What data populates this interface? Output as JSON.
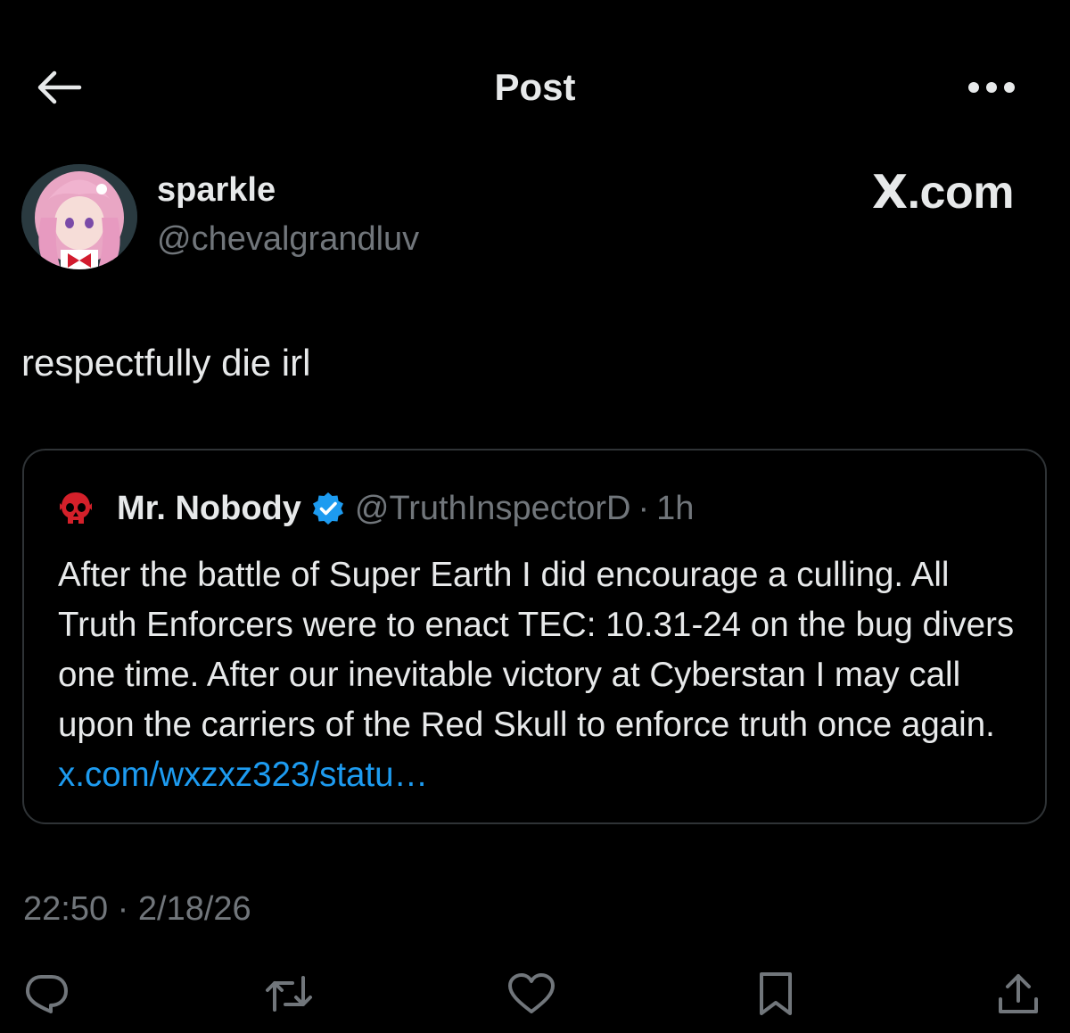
{
  "header": {
    "title": "Post",
    "back_icon": "arrow-left-icon",
    "more_icon": "more-horizontal-icon"
  },
  "author": {
    "display_name": "sparkle",
    "handle": "@chevalgrandluv",
    "avatar_icon": "profile-avatar"
  },
  "watermark": {
    "x": "X",
    "rest": ".com"
  },
  "post": {
    "text": "respectfully die irl"
  },
  "quote": {
    "display_name": "Mr. Nobody",
    "handle": "@TruthInspectorD",
    "separator": "·",
    "time": "1h",
    "body": "After the battle of Super Earth I did encourage a culling. All Truth Enforcers were to enact TEC: 10.31-24 on the bug divers one time. After our inevitable victory at Cyberstan I may call upon the carriers of the Red Skull to enforce truth once again.",
    "link": "x.com/wxzxz323/statu…",
    "verified_icon": "verified-badge-icon",
    "avatar_icon": "red-skull-icon"
  },
  "meta": {
    "time": "22:50",
    "separator": "·",
    "date": "2/18/26"
  },
  "actions": [
    {
      "icon": "reply-icon"
    },
    {
      "icon": "repost-icon"
    },
    {
      "icon": "like-icon"
    },
    {
      "icon": "bookmark-icon"
    },
    {
      "icon": "share-icon"
    }
  ],
  "colors": {
    "background": "#000000",
    "text": "#e7e9ea",
    "secondary": "#71767b",
    "link": "#1d9bf0",
    "border": "#2f3336",
    "verified": "#1d9bf0",
    "skull": "#d4202a"
  }
}
